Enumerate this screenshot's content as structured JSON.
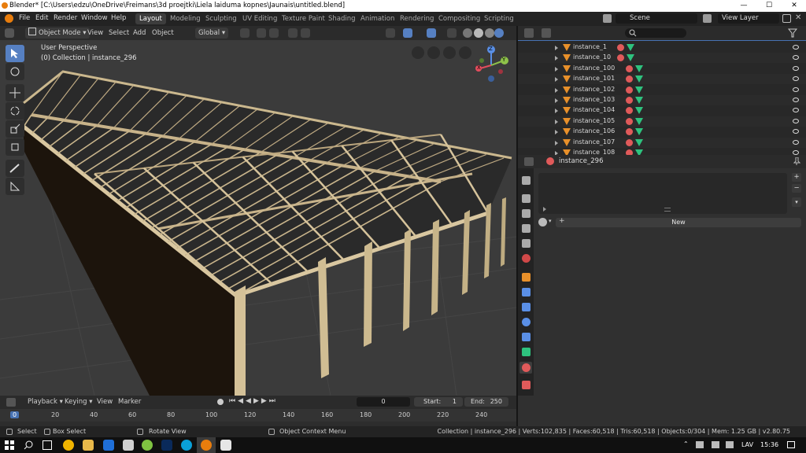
{
  "window": {
    "title": "Blender* [C:\\Users\\edzu\\OneDrive\\Freimans\\3d proejtki\\Liela laiduma kopnes\\Jaunais\\untitled.blend]",
    "minimize": "—",
    "maximize": "☐",
    "close": "✕"
  },
  "menubar": {
    "items": [
      "File",
      "Edit",
      "Render",
      "Window",
      "Help"
    ],
    "workspaces": [
      "Layout",
      "Modeling",
      "Sculpting",
      "UV Editing",
      "Texture Paint",
      "Shading",
      "Animation",
      "Rendering",
      "Compositing",
      "Scripting"
    ],
    "active_workspace": "Layout",
    "scene": "Scene",
    "view_layer": "View Layer"
  },
  "viewport_header": {
    "mode": "Object Mode",
    "menus": [
      "View",
      "Select",
      "Add",
      "Object"
    ],
    "orientation": "Global"
  },
  "viewport": {
    "perspective": "User Perspective",
    "collection": "(0) Collection | instance_296",
    "gizmo_axes": [
      "X",
      "Y",
      "Z"
    ]
  },
  "outliner": {
    "search_placeholder": "",
    "items": [
      "instance_1",
      "instance_10",
      "instance_100",
      "instance_101",
      "instance_102",
      "instance_103",
      "instance_104",
      "instance_105",
      "instance_106",
      "instance_107",
      "instance_108"
    ]
  },
  "properties": {
    "object_name": "instance_296",
    "new_button": "New"
  },
  "timeline": {
    "menus": [
      "Playback",
      "Keying",
      "View",
      "Marker"
    ],
    "current_frame": "0",
    "start_label": "Start:",
    "start": "1",
    "end_label": "End:",
    "end": "250",
    "ruler": [
      "0",
      "20",
      "40",
      "60",
      "80",
      "100",
      "120",
      "140",
      "160",
      "180",
      "200",
      "220",
      "240"
    ]
  },
  "statusbar": {
    "select": "Select",
    "box_select": "Box Select",
    "rotate_view": "Rotate View",
    "context_menu": "Object Context Menu",
    "stats": "Collection | instance_296 | Verts:102,835 | Faces:60,518 | Tris:60,518 | Objects:0/304 | Mem: 1.25 GB | v2.80.75"
  },
  "taskbar": {
    "language": "LAV",
    "time": "15:36"
  },
  "colors": {
    "accent": "#5680c2",
    "object_orange": "#e8902a",
    "mesh_green": "#2ec27e",
    "material_red": "#e05a5a",
    "timeline_frame": "#4772b3"
  }
}
